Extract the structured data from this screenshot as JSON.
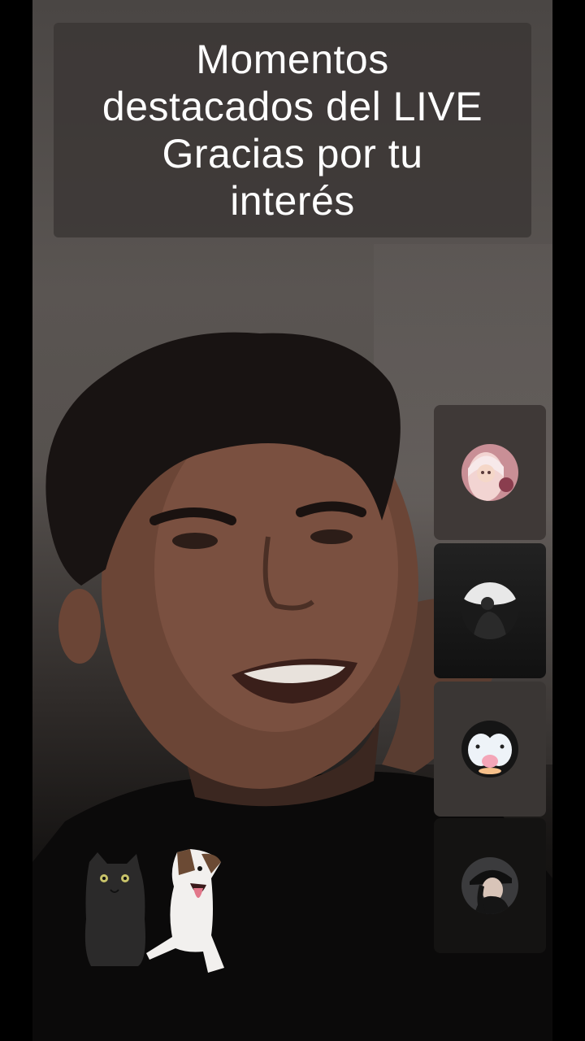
{
  "caption": {
    "lines": [
      "Momentos",
      "destacados del LIVE",
      "Gracias por tu",
      "interés"
    ]
  },
  "guests": [
    {
      "avatar": "pink-hooded-girl-avatar"
    },
    {
      "avatar": "dark-silhouette-avatar"
    },
    {
      "avatar": "cute-penguins-avatar"
    },
    {
      "avatar": "black-cap-woman-avatar"
    }
  ],
  "stickers": [
    "black-cat-sticker",
    "laughing-dog-sticker"
  ],
  "colors": {
    "caption_bg": "#3a3634",
    "caption_text": "#ffffff",
    "side_bars": "#000000"
  }
}
